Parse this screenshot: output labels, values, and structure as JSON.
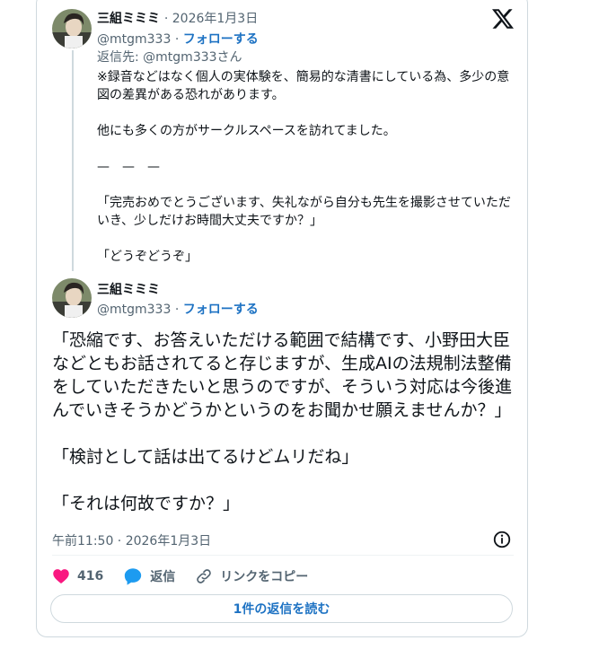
{
  "reply_tweet": {
    "display_name": "三組ミミミ",
    "date": "· 2026年1月3日",
    "handle": "@mtgm333",
    "separator": " · ",
    "follow_label": "フォローする",
    "replying_to": "返信先: @mtgm333さん",
    "paragraphs": [
      "※録音などはなく個人の実体験を、簡易的な清書にしている為、多少の意図の差異がある恐れがあります。",
      "他にも多くの方がサークルスペースを訪れてました。",
      "—　—　—",
      "「完売おめでとうございます、失礼ながら自分も先生を撮影させていただいき、少しだけお時間大丈夫ですか？」",
      "「どうぞどうぞ」"
    ]
  },
  "main_tweet": {
    "display_name": "三組ミミミ",
    "handle": "@mtgm333",
    "separator": " · ",
    "follow_label": "フォローする",
    "paragraphs": [
      "「恐縮です、お答えいただける範囲で結構です、小野田大臣などともお話されてると存じますが、生成AIの法規制法整備をしていただきたいと思うのですが、そういう対応は今後進んでいきそうかどうかというのをお聞かせ願えませんか？」",
      "「検討として話は出てるけどムリだね」",
      "「それは何故ですか？」"
    ],
    "timestamp": "午前11:50 · 2026年1月3日"
  },
  "actions": {
    "like_count": "416",
    "reply_label": "返信",
    "copy_link_label": "リンクをコピー"
  },
  "read_replies_label": "1件の返信を読む",
  "colors": {
    "accent": "#1d72c3",
    "like": "#f91880",
    "reply_icon": "#1d9bf0",
    "secondary_text": "#536471"
  }
}
